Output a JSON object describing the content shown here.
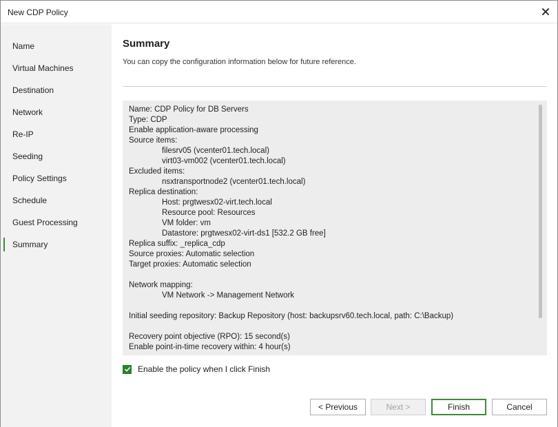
{
  "window": {
    "title": "New CDP Policy"
  },
  "sidebar": {
    "items": [
      {
        "label": "Name"
      },
      {
        "label": "Virtual Machines"
      },
      {
        "label": "Destination"
      },
      {
        "label": "Network"
      },
      {
        "label": "Re-IP"
      },
      {
        "label": "Seeding"
      },
      {
        "label": "Policy Settings"
      },
      {
        "label": "Schedule"
      },
      {
        "label": "Guest Processing"
      },
      {
        "label": "Summary"
      }
    ],
    "active_index": 9
  },
  "main": {
    "heading": "Summary",
    "subtitle": "You can copy the configuration information below for future reference.",
    "summary": {
      "lines": [
        {
          "text": "Name: CDP Policy for DB Servers",
          "indent": false
        },
        {
          "text": "Type: CDP",
          "indent": false
        },
        {
          "text": "Enable application-aware processing",
          "indent": false
        },
        {
          "text": "Source items:",
          "indent": false
        },
        {
          "text": "filesrv05 (vcenter01.tech.local)",
          "indent": true
        },
        {
          "text": "virt03-vm002 (vcenter01.tech.local)",
          "indent": true
        },
        {
          "text": "Excluded items:",
          "indent": false
        },
        {
          "text": "nsxtransportnode2 (vcenter01.tech.local)",
          "indent": true
        },
        {
          "text": "Replica destination:",
          "indent": false
        },
        {
          "text": "Host: prgtwesx02-virt.tech.local",
          "indent": true
        },
        {
          "text": "Resource pool: Resources",
          "indent": true
        },
        {
          "text": "VM folder: vm",
          "indent": true
        },
        {
          "text": "Datastore: prgtwesx02-virt-ds1 [532.2 GB free]",
          "indent": true
        },
        {
          "text": "Replica suffix: _replica_cdp",
          "indent": false
        },
        {
          "text": "Source proxies: Automatic selection",
          "indent": false
        },
        {
          "text": "Target proxies: Automatic selection",
          "indent": false
        },
        {
          "text": "",
          "indent": false
        },
        {
          "text": "Network mapping:",
          "indent": false
        },
        {
          "text": "VM Network -> Management Network",
          "indent": true
        },
        {
          "text": "",
          "indent": false
        },
        {
          "text": "Initial seeding repository: Backup Repository (host: backupsrv60.tech.local, path: C:\\Backup)",
          "indent": false
        },
        {
          "text": "",
          "indent": false
        },
        {
          "text": "Recovery point objective (RPO): 15 second(s)",
          "indent": false
        },
        {
          "text": "Enable point-in-time recovery within: 4 hour(s)",
          "indent": false
        }
      ]
    },
    "enable_policy": {
      "label": "Enable the policy when I click Finish",
      "checked": true
    }
  },
  "footer": {
    "previous_label": "< Previous",
    "next_label": "Next >",
    "finish_label": "Finish",
    "cancel_label": "Cancel"
  },
  "colors": {
    "accent": "#3b8a3b",
    "sidebar_bg": "#f2f2f2",
    "summary_bg": "#ededed"
  },
  "icons": {
    "close": "close-icon",
    "checkbox": "checkmark-icon"
  }
}
